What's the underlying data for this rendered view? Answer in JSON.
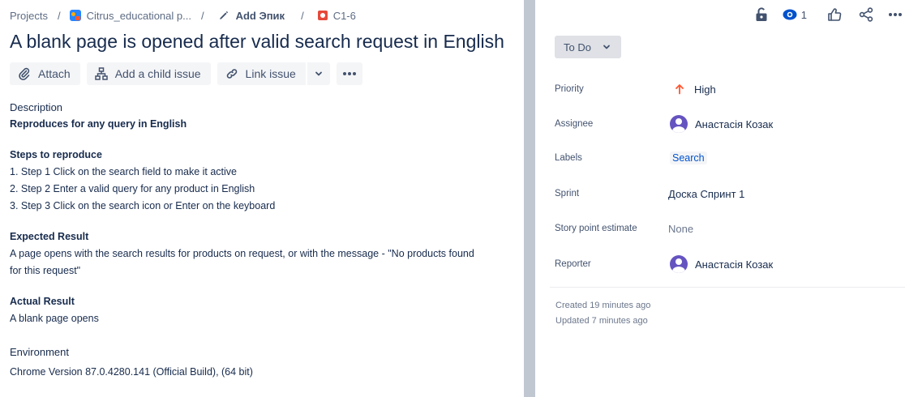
{
  "breadcrumb": {
    "projects": "Projects",
    "sep1": "/",
    "project": "Citrus_educational p...",
    "sep2": "/",
    "epic": "Add Эпик",
    "sep3": "/",
    "issue_key": "C1-6"
  },
  "issue": {
    "title": "A blank page is opened after valid search request in English"
  },
  "toolbar": {
    "attach": "Attach",
    "add_child": "Add a child issue",
    "link_issue": "Link issue"
  },
  "description": {
    "label": "Description",
    "summary": "Reproduces for any query in English",
    "steps_heading": "Steps to reproduce",
    "steps": [
      "1. Step 1 Click on the search field to make it active",
      "2. Step 2 Enter a valid query for any product in English",
      "3. Step 3 Click on the search icon or Enter on the keyboard"
    ],
    "expected_heading": "Expected Result",
    "expected_line1": "A page opens with the search results for products on request, or with the message - \"No products found",
    "expected_line2": "for this request\"",
    "actual_heading": "Actual Result",
    "actual": "A blank page opens",
    "environment_heading": "Environment",
    "environment": "Chrome Version 87.0.4280.141 (Official Build), (64 bit)"
  },
  "topbar": {
    "watch_count": "1",
    "icons": [
      "lock-icon",
      "eye-icon",
      "thumbs-up-icon",
      "share-icon",
      "more-icon"
    ]
  },
  "status": {
    "label": "To Do"
  },
  "fields": {
    "priority": {
      "label": "Priority",
      "value": "High",
      "color": "#ff5630"
    },
    "assignee": {
      "label": "Assignee",
      "value": "Анастасія Козак"
    },
    "labels": {
      "label": "Labels",
      "value": "Search"
    },
    "sprint": {
      "label": "Sprint",
      "value": "Доска Спринт 1"
    },
    "story_points": {
      "label": "Story point estimate",
      "value": "None"
    },
    "reporter": {
      "label": "Reporter",
      "value": "Анастасія Козак"
    }
  },
  "meta": {
    "created": "Created 19 minutes ago",
    "updated": "Updated 7 minutes ago"
  },
  "colors": {
    "accent": "#0052cc",
    "avatar": "#6554c0",
    "bug": "#e5493a"
  }
}
